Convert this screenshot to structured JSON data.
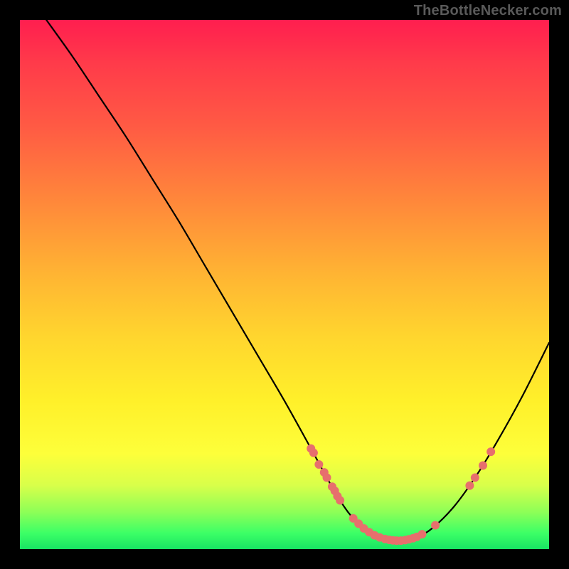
{
  "watermark": "TheBottleNecker.com",
  "colors": {
    "dot": "#e76f6d",
    "curve": "#000000"
  },
  "chart_data": {
    "type": "line",
    "title": "",
    "xlabel": "",
    "ylabel": "",
    "xlim": [
      0,
      100
    ],
    "ylim": [
      0,
      100
    ],
    "legend": false,
    "grid": false,
    "curve": {
      "x": [
        5,
        10,
        15,
        20,
        25,
        30,
        35,
        40,
        45,
        50,
        55,
        58,
        60,
        62,
        64,
        66,
        68,
        70,
        72,
        75,
        78,
        82,
        86,
        90,
        95,
        100
      ],
      "y": [
        100,
        93,
        85.5,
        78,
        70,
        62,
        53.5,
        45,
        36.5,
        28,
        19,
        13.5,
        10,
        7,
        4.8,
        3.2,
        2.2,
        1.7,
        1.6,
        2.2,
        4,
        8,
        13.5,
        20,
        29,
        39
      ]
    },
    "dots": [
      {
        "x": 55.0,
        "y": 19.0
      },
      {
        "x": 55.5,
        "y": 18.2
      },
      {
        "x": 56.5,
        "y": 16.0
      },
      {
        "x": 57.5,
        "y": 14.5
      },
      {
        "x": 58.0,
        "y": 13.5
      },
      {
        "x": 59.0,
        "y": 11.8
      },
      {
        "x": 59.5,
        "y": 11.0
      },
      {
        "x": 60.0,
        "y": 10.0
      },
      {
        "x": 60.5,
        "y": 9.2
      },
      {
        "x": 63.0,
        "y": 5.8
      },
      {
        "x": 64.0,
        "y": 4.8
      },
      {
        "x": 65.0,
        "y": 3.9
      },
      {
        "x": 66.0,
        "y": 3.2
      },
      {
        "x": 67.0,
        "y": 2.6
      },
      {
        "x": 68.0,
        "y": 2.2
      },
      {
        "x": 69.0,
        "y": 1.9
      },
      {
        "x": 69.8,
        "y": 1.75
      },
      {
        "x": 70.5,
        "y": 1.65
      },
      {
        "x": 71.2,
        "y": 1.6
      },
      {
        "x": 72.0,
        "y": 1.6
      },
      {
        "x": 72.8,
        "y": 1.7
      },
      {
        "x": 73.5,
        "y": 1.85
      },
      {
        "x": 74.3,
        "y": 2.05
      },
      {
        "x": 75.0,
        "y": 2.3
      },
      {
        "x": 76.0,
        "y": 2.8
      },
      {
        "x": 78.5,
        "y": 4.5
      },
      {
        "x": 85.0,
        "y": 12.0
      },
      {
        "x": 86.0,
        "y": 13.5
      },
      {
        "x": 87.5,
        "y": 15.8
      },
      {
        "x": 89.0,
        "y": 18.4
      }
    ]
  }
}
